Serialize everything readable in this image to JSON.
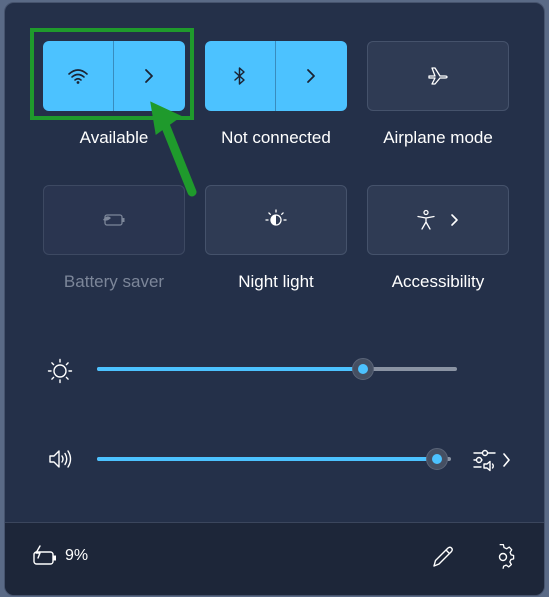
{
  "tiles": {
    "wifi": {
      "label": "Available",
      "state": "on",
      "icon": "wifi-icon",
      "expand_icon": "chevron-right-icon"
    },
    "bluetooth": {
      "label": "Not connected",
      "state": "on",
      "icon": "bluetooth-icon",
      "expand_icon": "chevron-right-icon"
    },
    "airplane": {
      "label": "Airplane mode",
      "state": "off",
      "icon": "airplane-icon"
    },
    "battery_saver": {
      "label": "Battery saver",
      "state": "disabled",
      "icon": "battery-saver-icon"
    },
    "night_light": {
      "label": "Night light",
      "state": "off",
      "icon": "night-light-icon"
    },
    "accessibility": {
      "label": "Accessibility",
      "state": "off",
      "icon": "accessibility-icon",
      "expand_icon": "chevron-right-icon"
    }
  },
  "brightness": {
    "icon": "brightness-icon",
    "level": 0.74
  },
  "volume": {
    "icon": "speaker-icon",
    "level": 0.96,
    "mixer_icon": "audio-mixer-icon"
  },
  "footer": {
    "battery_icon": "battery-charging-icon",
    "battery_percent": "9%",
    "edit_icon": "pencil-icon",
    "settings_icon": "gear-icon"
  },
  "colors": {
    "accent": "#4cc2ff",
    "panel": "#243049",
    "annotation": "#1f9a2c"
  }
}
